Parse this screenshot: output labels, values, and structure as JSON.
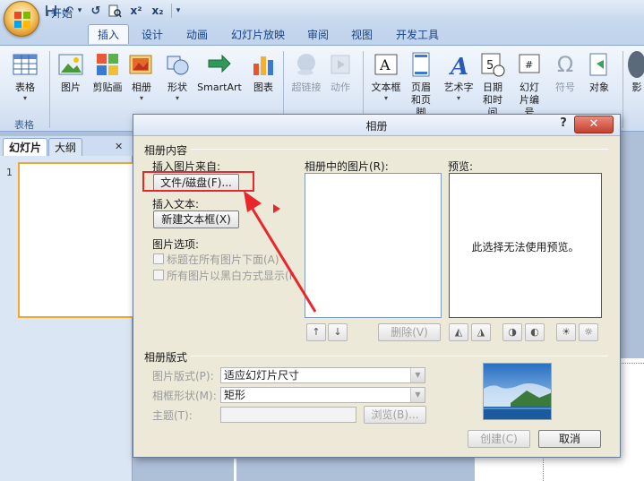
{
  "quick_access": {
    "office_button": "Office",
    "save": "save-icon",
    "undo": "↶",
    "undo_dropdown": "▾",
    "redo": "↺",
    "print_preview": "print-preview-icon",
    "superscript": "x²",
    "subscript": "x₂",
    "customize": "▾"
  },
  "ribbon_tabs": [
    "开始",
    "插入",
    "设计",
    "动画",
    "幻灯片放映",
    "审阅",
    "视图",
    "开发工具"
  ],
  "active_tab": "插入",
  "ribbon": {
    "table_group": {
      "button": "表格",
      "dropdown": "▾",
      "label": "表格"
    },
    "buttons": [
      {
        "label": "图片",
        "icon": "picture-icon"
      },
      {
        "label": "剪贴画",
        "icon": "clipart-icon"
      },
      {
        "label": "相册",
        "icon": "album-icon"
      },
      {
        "label": "形状",
        "icon": "shapes-icon"
      },
      {
        "label": "SmartArt",
        "icon": "smartart-icon"
      },
      {
        "label": "图表",
        "icon": "chart-icon"
      },
      {
        "label": "超链接",
        "icon": "hyperlink-icon",
        "disabled": true
      },
      {
        "label": "动作",
        "icon": "action-icon",
        "disabled": true
      },
      {
        "label": "文本框",
        "icon": "textbox-icon"
      },
      {
        "label": "页眉和页脚",
        "icon": "header-footer-icon"
      },
      {
        "label": "艺术字",
        "icon": "wordart-icon"
      },
      {
        "label": "日期和时间",
        "icon": "datetime-icon"
      },
      {
        "label": "幻灯片编号",
        "icon": "slide-number-icon"
      },
      {
        "label": "符号",
        "icon": "symbol-icon",
        "disabled": true
      },
      {
        "label": "对象",
        "icon": "object-icon"
      },
      {
        "label": "影",
        "icon": "media-icon"
      }
    ]
  },
  "pane": {
    "tabs": [
      "幻灯片",
      "大纲"
    ],
    "slide_number": "1"
  },
  "dialog": {
    "title": "相册",
    "help": "?",
    "close": "✕",
    "content_section": "相册内容",
    "insert_from_label": "插入图片来自:",
    "file_disk_button": "文件/磁盘(F)...",
    "insert_text_label": "插入文本:",
    "new_textbox_button": "新建文本框(X)",
    "picture_options_label": "图片选项:",
    "option_caption": "标题在所有图片下面(A)",
    "option_bw": "所有图片以黑白方式显示(K)",
    "pictures_in_album_label": "相册中的图片(R):",
    "preview_label": "预览:",
    "preview_message": "此选择无法使用预览。",
    "move_up": "↑",
    "move_down": "↓",
    "remove_button": "删除(V)",
    "layout_section": "相册版式",
    "picture_layout_label": "图片版式(P):",
    "picture_layout_value": "适应幻灯片尺寸",
    "frame_shape_label": "相框形状(M):",
    "frame_shape_value": "矩形",
    "theme_label": "主题(T):",
    "theme_value": "",
    "browse_button": "浏览(B)...",
    "create_button": "创建(C)",
    "cancel_button": "取消"
  },
  "colors": {
    "accent": "#e8262b",
    "ribbon_blue": "#15428b",
    "slide_border": "#f0a732"
  }
}
